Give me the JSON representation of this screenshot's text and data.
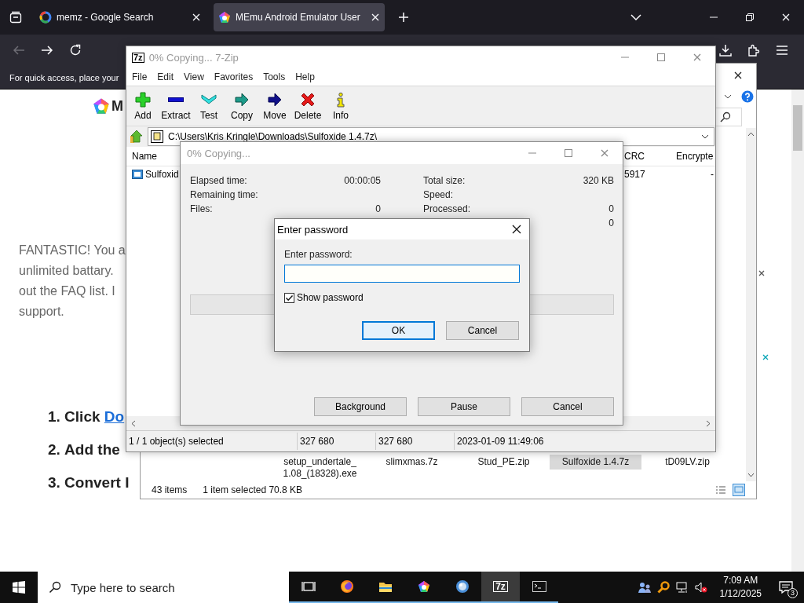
{
  "browser": {
    "tabs": [
      {
        "title": "memz - Google Search",
        "kind": "google",
        "selected": false
      },
      {
        "title": "MEmu Android Emulator User",
        "kind": "memu",
        "selected": true
      }
    ],
    "back": {
      "disabled": true
    },
    "bookmarks_hint": "For quick access, place your",
    "page": {
      "logo_text": "M",
      "paragraph": [
        "FANTASTIC! You a",
        "unlimited battary.",
        "out the FAQ list. I",
        "support."
      ],
      "steps": [
        {
          "number": "1.",
          "text": "Click ",
          "link": "Do"
        },
        {
          "number": "2.",
          "text": "Add the"
        },
        {
          "number": "3.",
          "text": "Convert I"
        }
      ]
    }
  },
  "explorer": {
    "files": [
      {
        "name": "setup_undertale_\n1.08_(18328).exe",
        "selected": false
      },
      {
        "name": "slimxmas.7z",
        "selected": false
      },
      {
        "name": "Stud_PE.zip",
        "selected": false
      },
      {
        "name": "Sulfoxide 1.4.7z",
        "selected": true
      },
      {
        "name": "tD09LV.zip",
        "selected": false
      }
    ],
    "status": [
      "43 items",
      "1 item selected  70.8 KB"
    ]
  },
  "sevenzip": {
    "icon_label": "7z",
    "title": "0% Copying... 7-Zip",
    "active": false,
    "menu": [
      "File",
      "Edit",
      "View",
      "Favorites",
      "Tools",
      "Help"
    ],
    "toolbar": [
      {
        "label": "Add",
        "kind": "add"
      },
      {
        "label": "Extract",
        "kind": "extract"
      },
      {
        "label": "Test",
        "kind": "test"
      },
      {
        "label": "Copy",
        "kind": "copy"
      },
      {
        "label": "Move",
        "kind": "move"
      },
      {
        "label": "Delete",
        "kind": "delete"
      },
      {
        "label": "Info",
        "kind": "info"
      }
    ],
    "path": "C:\\Users\\Kris Kringle\\Downloads\\Sulfoxide 1.4.7z\\",
    "columns": [
      "Name",
      "CRC",
      "Encrypte"
    ],
    "rows": [
      {
        "name": "Sulfoxid",
        "crc": "5917",
        "encrypted": "-"
      }
    ],
    "status": [
      "1 / 1 object(s) selected",
      "327 680",
      "327 680",
      "2023-01-09 11:49:06"
    ]
  },
  "copying": {
    "title": "0% Copying...",
    "active": false,
    "left": [
      {
        "label": "Elapsed time:",
        "value": "00:00:05"
      },
      {
        "label": "Remaining time:"
      },
      {
        "label": "Files:",
        "value": "0"
      }
    ],
    "right": [
      {
        "label": "Total size:",
        "value": "320 KB"
      },
      {
        "label": "Speed:"
      },
      {
        "label": "Processed:",
        "value": "0"
      },
      {
        "value": "0"
      }
    ],
    "progress": {
      "level": 0
    },
    "buttons": [
      "Background",
      "Pause",
      "Cancel"
    ]
  },
  "password": {
    "title": "Enter password",
    "active": true,
    "label": "Enter password:",
    "show_password": {
      "label": "Show password",
      "checked": true
    },
    "buttons": [
      {
        "label": "OK",
        "default": true
      },
      {
        "label": "Cancel",
        "default": false
      }
    ]
  },
  "taskbar": {
    "search_placeholder": "Type here to search",
    "apps": [
      {
        "kind": "taskview",
        "active": false
      },
      {
        "kind": "firefox",
        "active": false
      },
      {
        "kind": "folder",
        "active": false
      },
      {
        "kind": "memu",
        "active": false
      },
      {
        "kind": "globe",
        "active": false
      },
      {
        "kind": "sevenzip",
        "label": "7z",
        "active": true
      },
      {
        "kind": "terminal",
        "active": false
      }
    ],
    "time": "7:09 AM",
    "date": "1/12/2025",
    "notifications": "3"
  }
}
